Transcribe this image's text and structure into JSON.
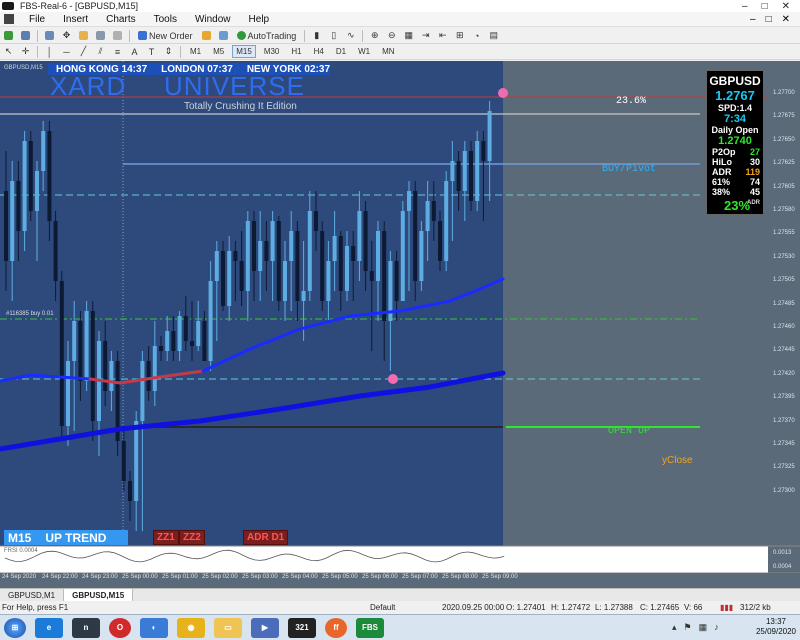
{
  "window": {
    "title": "FBS-Real-6 - [GBPUSD,M15]",
    "controls": [
      "–",
      "□",
      "✕"
    ]
  },
  "menu": {
    "items": [
      "File",
      "Insert",
      "Charts",
      "Tools",
      "Window",
      "Help"
    ],
    "mdi_controls": [
      "–",
      "□",
      "✕"
    ]
  },
  "toolbar": {
    "new_order_label": "New Order",
    "autotrading_label": "AutoTrading",
    "timeframes": [
      "M1",
      "M5",
      "M15",
      "M30",
      "H1",
      "H4",
      "D1",
      "W1",
      "MN"
    ],
    "active_timeframe": "M15"
  },
  "chart": {
    "symbol_label": "GBPUSD,M15",
    "sessions": {
      "hong_kong": "HONG KONG 14:37",
      "london": "LONDON 07:37",
      "new_york": "NEW YORK 02:37"
    },
    "brand_left": "XARD",
    "brand_right": "UNIVERSE",
    "edition": "Totally Crushing It Edition",
    "fib_label": "23.6%",
    "buy_pivot_label": "BUY/Pivot",
    "open_up_label": "OPEN UP",
    "yclose_label": "yClose",
    "trade_label": "#116385 buy 0.01",
    "trend_tf": "M15",
    "trend_text": "UP TREND",
    "zz1": "ZZ1",
    "zz2": "ZZ2",
    "adr_d1": "ADR D1",
    "subwindow_label": "FRSI 0.0004",
    "y_axis_ticks": [
      "1.27700",
      "1.27675",
      "1.27650",
      "1.27625",
      "1.27605",
      "1.27580",
      "1.27555",
      "1.27530",
      "1.27505",
      "1.27485",
      "1.27460",
      "1.27445",
      "1.27420",
      "1.27395",
      "1.27370",
      "1.27345",
      "1.27325",
      "1.27300"
    ],
    "sub_axis_ticks": [
      "0.0013",
      "0.0004"
    ],
    "x_axis_ticks": [
      "24 Sep 2020",
      "24 Sep 22:00",
      "24 Sep 23:00",
      "25 Sep 00:00",
      "25 Sep 01:00",
      "25 Sep 02:00",
      "25 Sep 03:00",
      "25 Sep 04:00",
      "25 Sep 05:00",
      "25 Sep 06:00",
      "25 Sep 07:00",
      "25 Sep 08:00",
      "25 Sep 09:00"
    ]
  },
  "panel": {
    "symbol": "GBPUSD",
    "price": "1.2767",
    "spread": "SPD:1.4",
    "time": "7:34",
    "daily_open_label": "Daily Open",
    "daily_open": "1.2740",
    "rows": [
      {
        "label": "P2Op",
        "value": "27",
        "color": "#2ee62e"
      },
      {
        "label": "HiLo",
        "value": "30",
        "color": "#ffffff"
      },
      {
        "label": "ADR",
        "value": "119",
        "color": "#f4a21b"
      },
      {
        "label": "61%",
        "value": "74",
        "color": "#ffffff"
      },
      {
        "label": "38%",
        "value": "45",
        "color": "#ffffff"
      }
    ],
    "adr_pct": "23%",
    "adr_small": "ADR"
  },
  "tabs": [
    "GBPUSD,M1",
    "GBPUSD,M15"
  ],
  "active_tab": "GBPUSD,M15",
  "status": {
    "help": "For Help, press F1",
    "profile": "Default",
    "datetime": "2020.09.25 00:00",
    "open": "O: 1.27401",
    "high": "H: 1.27472",
    "low": "L: 1.27388",
    "close": "C: 1.27465",
    "volume": "V: 66",
    "traffic": "312/2 kb"
  },
  "taskbar": {
    "apps": [
      "start",
      "ie",
      "note",
      "opera",
      "chrome-alt",
      "chrome",
      "explorer",
      "media",
      "app321",
      "firefox",
      "fbs"
    ],
    "time": "13:37",
    "date": "25/09/2020"
  },
  "colors": {
    "chart_bg": "#2e4a7c",
    "future_bg": "#5a6a78",
    "bull_candle": "#5dade2",
    "bear_candle": "#2e4a7c",
    "ma_fast": "#1a1aff",
    "ma_slow": "#1010e0",
    "ma_red": "#c23a4b"
  }
}
